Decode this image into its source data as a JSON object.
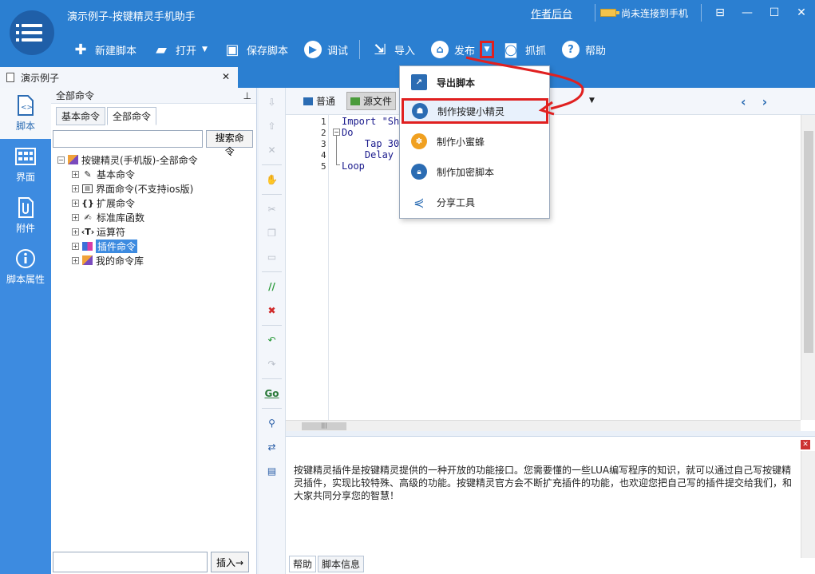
{
  "app": {
    "title": "演示例子-按键精灵手机助手",
    "admin_link": "作者后台",
    "phone_status": "尚未连接到手机"
  },
  "ribbon": {
    "new": "新建脚本",
    "open": "打开",
    "save": "保存脚本",
    "debug": "调试",
    "import": "导入",
    "publish": "发布",
    "capture": "抓抓",
    "help": "帮助"
  },
  "doc_tab": {
    "title": "演示例子"
  },
  "left_nav": [
    "脚本",
    "界面",
    "附件",
    "脚本属性"
  ],
  "command_panel": {
    "header": "全部命令",
    "tabs": [
      "基本命令",
      "全部命令"
    ],
    "search_button": "搜索命令",
    "insert_button": "插入→",
    "tree": {
      "root": "按键精灵(手机版)-全部命令",
      "children": [
        "基本命令",
        "界面命令(不支持ios版)",
        "扩展命令",
        "标准库函数",
        "运算符",
        "插件命令",
        "我的命令库"
      ]
    }
  },
  "editor": {
    "modes": [
      "普通",
      "源文件"
    ],
    "line_numbers": [
      "1",
      "2",
      "3",
      "4",
      "5"
    ],
    "lines": [
      "Import \"Sh",
      "Do",
      "    Tap 30",
      "    Delay",
      "Loop"
    ]
  },
  "publish_menu": {
    "items": [
      "导出脚本",
      "制作按键小精灵",
      "制作小蜜蜂",
      "制作加密脚本",
      "分享工具"
    ]
  },
  "help": {
    "text": "按键精灵插件是按键精灵提供的一种开放的功能接口。您需要懂的一些LUA编写程序的知识，就可以通过自己写按键精灵插件，实现比较特殊、高级的功能。按键精灵官方会不断扩充插件的功能，也欢迎您把自己写的插件提交给我们，和大家共同分享您的智慧！",
    "tabs": [
      "帮助",
      "脚本信息"
    ]
  },
  "colors": {
    "accent": "#2b7fd1",
    "highlight_red": "#e02020"
  }
}
